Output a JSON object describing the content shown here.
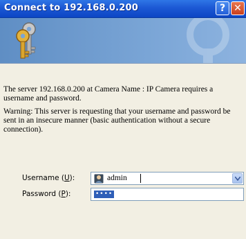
{
  "window": {
    "title": "Connect to 192.168.0.200"
  },
  "titlebar": {
    "help_glyph": "?",
    "close_glyph": "✕"
  },
  "banner": {
    "icon": "keys-icon"
  },
  "messages": {
    "server": "The server 192.168.0.200 at Camera Name : IP Camera requires a username and password.",
    "warning": "Warning: This server is requesting that your username and password be sent in an insecure manner (basic authentication without a secure connection)."
  },
  "form": {
    "username_label": "Username (U):",
    "username_value": "admin",
    "password_label": "Password (P):",
    "password_mask": "••••"
  },
  "colors": {
    "titlebar": "#1c58d4",
    "banner": "#7aa5d6",
    "dialog_bg": "#f2efe3"
  }
}
